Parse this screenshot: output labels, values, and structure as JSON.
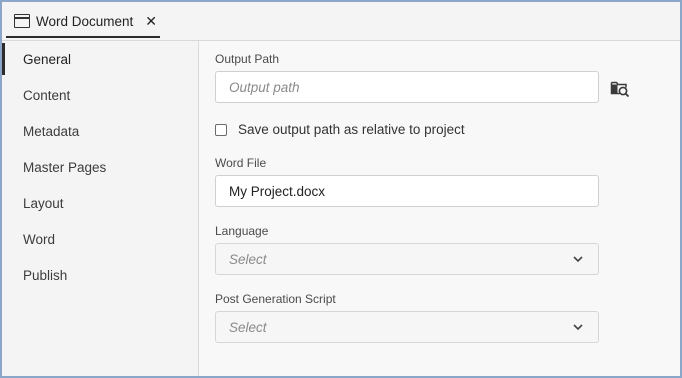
{
  "tab": {
    "title": "Word Document",
    "icon": "document-window-icon",
    "close_glyph": "✕"
  },
  "sidebar": {
    "items": [
      {
        "label": "General",
        "active": true
      },
      {
        "label": "Content",
        "active": false
      },
      {
        "label": "Metadata",
        "active": false
      },
      {
        "label": "Master Pages",
        "active": false
      },
      {
        "label": "Layout",
        "active": false
      },
      {
        "label": "Word",
        "active": false
      },
      {
        "label": "Publish",
        "active": false
      }
    ]
  },
  "form": {
    "output_path": {
      "label": "Output Path",
      "value": "",
      "placeholder": "Output path",
      "browse_icon": "folder-search-icon"
    },
    "relative_checkbox": {
      "label": "Save output path as relative to project",
      "checked": false
    },
    "word_file": {
      "label": "Word File",
      "value": "My Project.docx"
    },
    "language": {
      "label": "Language",
      "selected": "Select"
    },
    "post_generation_script": {
      "label": "Post Generation Script",
      "selected": "Select"
    }
  },
  "colors": {
    "frame_border": "#8aa6c8",
    "active_indicator": "#2c2c2c"
  }
}
